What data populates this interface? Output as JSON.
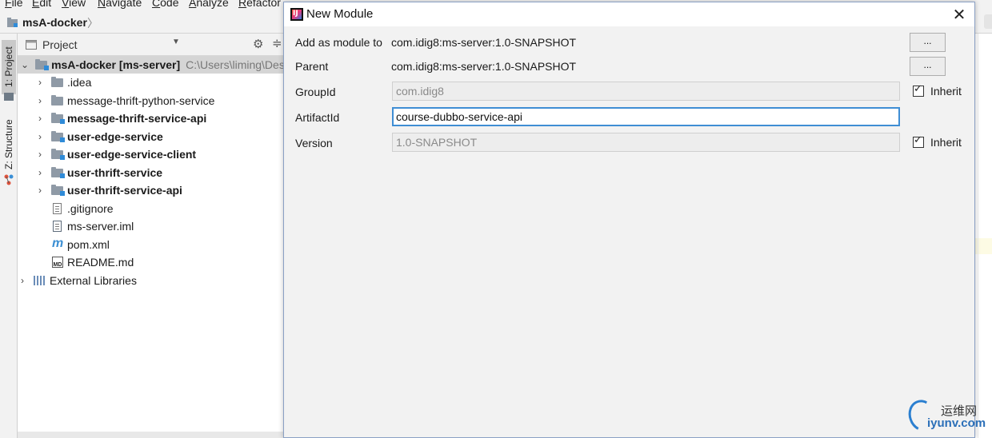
{
  "menubar": {
    "items": [
      "File",
      "Edit",
      "View",
      "Navigate",
      "Code",
      "Analyze",
      "Refactor"
    ]
  },
  "navbar": {
    "breadcrumb": "msA-docker",
    "chevron": "〉"
  },
  "left_strip": {
    "tabs": [
      "1: Project",
      "Z: Structure"
    ]
  },
  "project_panel": {
    "title": "Project",
    "dropdown_arrow": "▼",
    "gear_glyph": "⚙",
    "split_glyph": "≑",
    "tree": [
      {
        "label": "msA-docker [ms-server]",
        "path": "C:\\Users\\liming\\Desk",
        "bold": true,
        "icon": "module-folder-icon",
        "expand": "⌄"
      },
      {
        "label": ".idea",
        "bold": false,
        "icon": "folder-icon",
        "expand": "›"
      },
      {
        "label": "message-thrift-python-service",
        "bold": false,
        "icon": "folder-icon",
        "expand": "›"
      },
      {
        "label": "message-thrift-service-api",
        "bold": true,
        "icon": "module-folder-icon",
        "expand": "›"
      },
      {
        "label": "user-edge-service",
        "bold": true,
        "icon": "module-folder-icon",
        "expand": "›"
      },
      {
        "label": "user-edge-service-client",
        "bold": true,
        "icon": "module-folder-icon",
        "expand": "›"
      },
      {
        "label": "user-thrift-service",
        "bold": true,
        "icon": "module-folder-icon",
        "expand": "›"
      },
      {
        "label": "user-thrift-service-api",
        "bold": true,
        "icon": "module-folder-icon",
        "expand": "›"
      },
      {
        "label": ".gitignore",
        "bold": false,
        "icon": "text-file-icon",
        "expand": ""
      },
      {
        "label": "ms-server.iml",
        "bold": false,
        "icon": "iml-file-icon",
        "expand": ""
      },
      {
        "label": "pom.xml",
        "bold": false,
        "icon": "maven-icon",
        "expand": ""
      },
      {
        "label": "README.md",
        "bold": false,
        "icon": "markdown-icon",
        "expand": ""
      },
      {
        "label": "External Libraries",
        "bold": false,
        "icon": "libraries-icon",
        "expand": "›"
      }
    ]
  },
  "dialog": {
    "title": "New Module",
    "close_glyph": "✕",
    "add_as_module_label": "Add as module to",
    "add_as_module_value": "com.idig8:ms-server:1.0-SNAPSHOT",
    "parent_label": "Parent",
    "parent_value": "com.idig8:ms-server:1.0-SNAPSHOT",
    "browse_label": "...",
    "group_id_label": "GroupId",
    "group_id_value": "com.idig8",
    "artifact_id_label": "ArtifactId",
    "artifact_id_value": "course-dubbo-service-api",
    "version_label": "Version",
    "version_value": "1.0-SNAPSHOT",
    "inherit_label": "Inherit",
    "check_glyph": "✓"
  },
  "watermark": {
    "cn": "运维网",
    "en": "iyunv.com"
  }
}
